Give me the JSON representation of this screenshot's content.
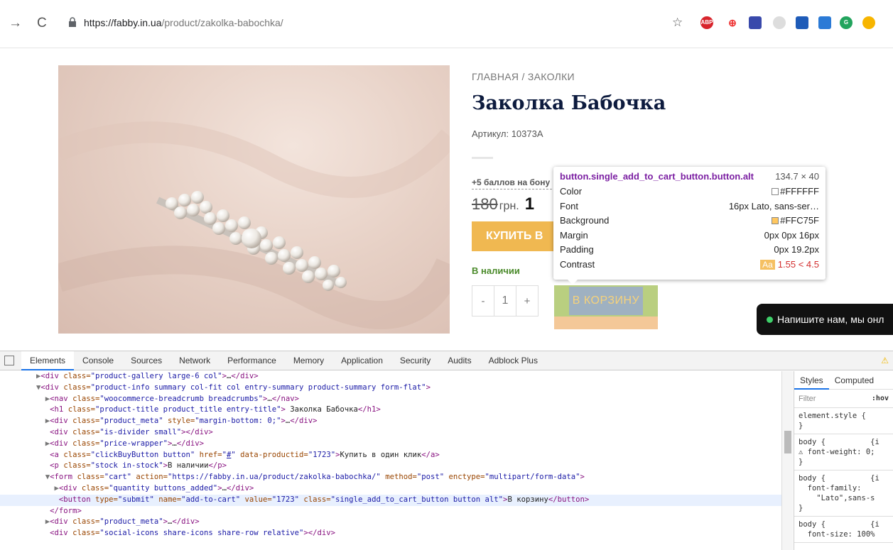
{
  "browser": {
    "url_host": "https://fabby.in.ua",
    "url_path": "/product/zakolka-babochka/"
  },
  "product": {
    "breadcrumb": "ГЛАВНАЯ / ЗАКОЛКИ",
    "title": "Заколка Бабочка",
    "sku": "Артикул: 10373A",
    "bonus": "+5 баллов на бону",
    "old_price": "180",
    "currency": "грн.",
    "current_price": "1",
    "buy_one_click": "КУПИТЬ В",
    "in_stock": "В наличии",
    "qty_minus": "-",
    "qty_value": "1",
    "qty_plus": "+",
    "add_to_cart": "В КОРЗИНУ"
  },
  "tooltip": {
    "selector": "button.single_add_to_cart_button.button.alt",
    "dimensions": "134.7 × 40",
    "rows": [
      {
        "label": "Color",
        "value": "#FFFFFF"
      },
      {
        "label": "Font",
        "value": "16px Lato, sans-ser…"
      },
      {
        "label": "Background",
        "value": "#FFC75F"
      },
      {
        "label": "Margin",
        "value": "0px 0px 16px"
      },
      {
        "label": "Padding",
        "value": "0px 19.2px"
      },
      {
        "label": "Contrast",
        "value": "1.55 < 4.5"
      }
    ],
    "contrast_badge": "Aa",
    "colors": {
      "color_swatch": "#FFFFFF",
      "background_swatch": "#FFC75F"
    }
  },
  "chat": {
    "text": "Напишите нам, мы онл"
  },
  "devtools": {
    "tabs": [
      "Elements",
      "Console",
      "Sources",
      "Network",
      "Performance",
      "Memory",
      "Application",
      "Security",
      "Audits",
      "Adblock Plus"
    ],
    "active_tab": "Elements",
    "styles_tabs": [
      "Styles",
      "Computed"
    ],
    "filter_placeholder": "Filter",
    "hov": ":hov",
    "style_rules": [
      {
        "text": "element.style {\n}"
      },
      {
        "text": "body {          {i\n⚠ font-weight: 0;\n}"
      },
      {
        "text": "body {          {i\n  font-family:\n    \"Lato\",sans-s\n}"
      },
      {
        "text": "body {          {i\n  font-size: 100%"
      }
    ]
  }
}
